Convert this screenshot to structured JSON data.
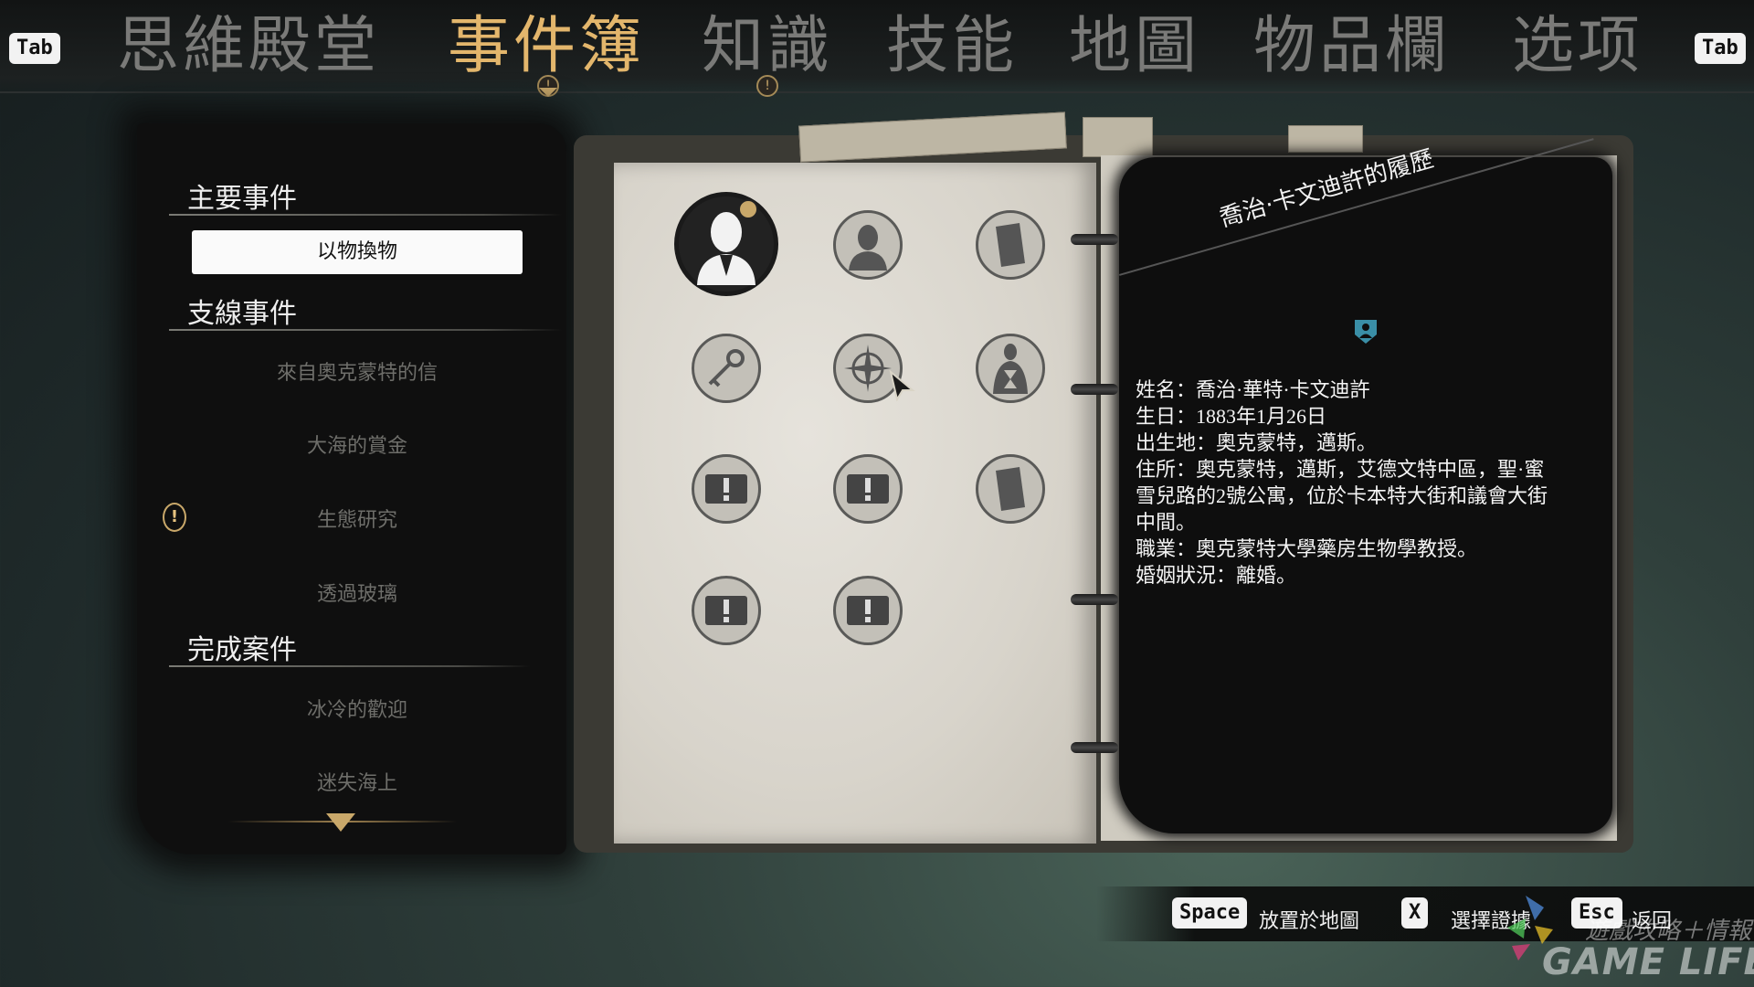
{
  "nav": {
    "left_key": "Tab",
    "right_key": "Tab",
    "tabs": [
      "思維殿堂",
      "事件簿",
      "知識",
      "技能",
      "地圖",
      "物品欄",
      "选项"
    ],
    "active_tab": "事件簿",
    "alert_glyph": "!"
  },
  "case_list": {
    "main_title": "主要事件",
    "main_items": [
      "以物換物"
    ],
    "side_title": "支線事件",
    "side_items": [
      "來自奧克蒙特的信",
      "大海的賞金",
      "生態研究",
      "透過玻璃"
    ],
    "done_title": "完成案件",
    "done_items": [
      "冰冷的歡迎",
      "迷失海上"
    ],
    "selected": "以物換物",
    "alert_on": "生態研究"
  },
  "evidence": [
    {
      "icon": "person-silhouette-icon",
      "selected": true
    },
    {
      "icon": "bust-icon"
    },
    {
      "icon": "document-icon"
    },
    {
      "icon": "key-icon"
    },
    {
      "icon": "compass-icon"
    },
    {
      "icon": "hourglass-person-icon"
    },
    {
      "icon": "unknown-exclamation-icon"
    },
    {
      "icon": "unknown-exclamation-icon"
    },
    {
      "icon": "document-icon"
    },
    {
      "icon": "unknown-exclamation-icon"
    },
    {
      "icon": "unknown-exclamation-icon"
    }
  ],
  "detail": {
    "title": "喬治·卡文迪許的履歷",
    "lines": [
      "姓名：喬治·華特·卡文迪許",
      "生日：1883年1月26日",
      "出生地：奧克蒙特，邁斯。",
      "住所：奧克蒙特，邁斯，艾德文特中區，聖·蜜",
      "雪兒路的2號公寓，位於卡本特大街和議會大街",
      "中間。",
      "職業：奧克蒙特大學藥房生物學教授。",
      "婚姻狀況：離婚。"
    ]
  },
  "hints": [
    {
      "key": "Space",
      "label": "放置於地圖"
    },
    {
      "key": "X",
      "label": "選擇證據"
    },
    {
      "key": "Esc",
      "label": "返回"
    }
  ],
  "watermark": {
    "line1": "遊戲攻略＋情報",
    "line2": "GAME LIFE"
  },
  "colors": {
    "accent": "#e3b66c",
    "inactive_tab": "#7a7a78",
    "ink": "#0e0e0e",
    "page": "#dcd8cf"
  }
}
